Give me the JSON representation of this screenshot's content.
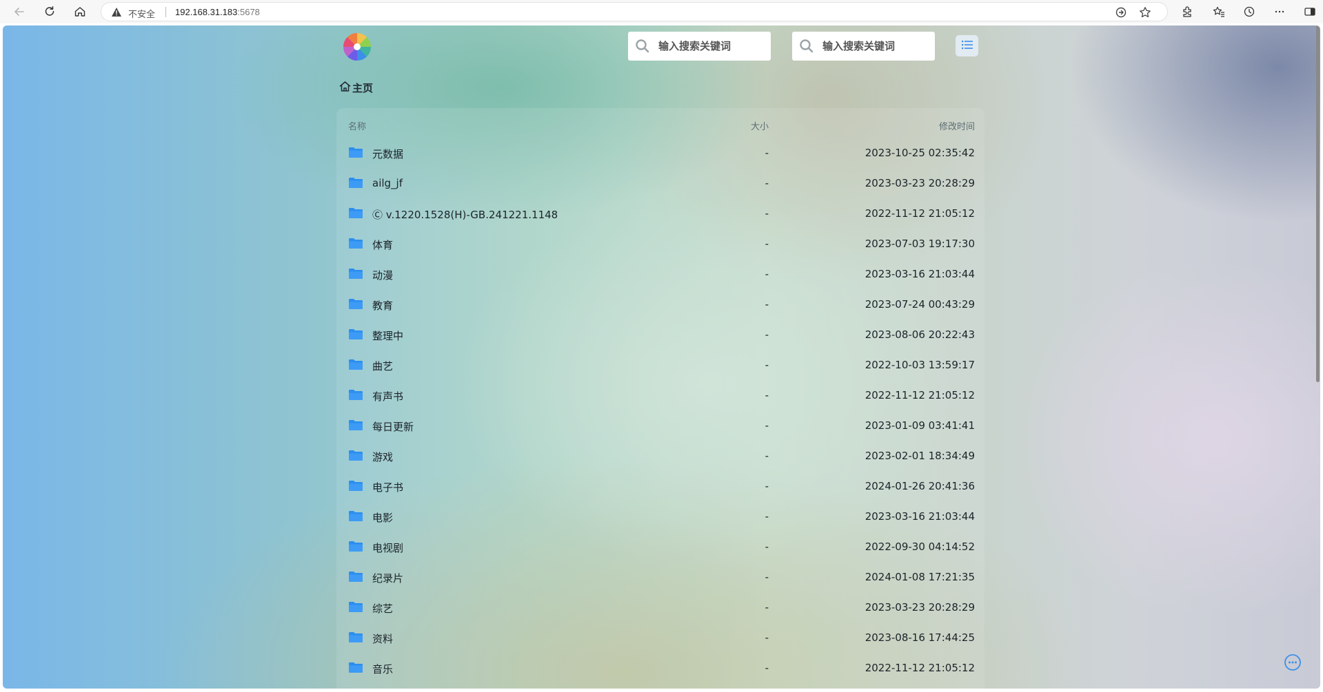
{
  "browser": {
    "security_label": "不安全",
    "url_host": "192.168.31.183",
    "url_port": ":5678"
  },
  "search": {
    "first_placeholder": "输入搜索关键词",
    "second_placeholder": "输入搜索关键词"
  },
  "breadcrumb": {
    "home_label": "主页"
  },
  "list": {
    "header": {
      "name": "名称",
      "size": "大小",
      "modified": "修改时间"
    },
    "rows": [
      {
        "name": "元数据",
        "size": "-",
        "modified": "2023-10-25 02:35:42"
      },
      {
        "name": "ailg_jf",
        "size": "-",
        "modified": "2023-03-23 20:28:29"
      },
      {
        "name": "Ⓒ v.1220.1528(H)-GB.241221.1148",
        "size": "-",
        "modified": "2022-11-12 21:05:12"
      },
      {
        "name": "体育",
        "size": "-",
        "modified": "2023-07-03 19:17:30"
      },
      {
        "name": "动漫",
        "size": "-",
        "modified": "2023-03-16 21:03:44"
      },
      {
        "name": "教育",
        "size": "-",
        "modified": "2023-07-24 00:43:29"
      },
      {
        "name": "整理中",
        "size": "-",
        "modified": "2023-08-06 20:22:43"
      },
      {
        "name": "曲艺",
        "size": "-",
        "modified": "2022-10-03 13:59:17"
      },
      {
        "name": "有声书",
        "size": "-",
        "modified": "2022-11-12 21:05:12"
      },
      {
        "name": "每日更新",
        "size": "-",
        "modified": "2023-01-09 03:41:41"
      },
      {
        "name": "游戏",
        "size": "-",
        "modified": "2023-02-01 18:34:49"
      },
      {
        "name": "电子书",
        "size": "-",
        "modified": "2024-01-26 20:41:36"
      },
      {
        "name": "电影",
        "size": "-",
        "modified": "2023-03-16 21:03:44"
      },
      {
        "name": "电视剧",
        "size": "-",
        "modified": "2022-09-30 04:14:52"
      },
      {
        "name": "纪录片",
        "size": "-",
        "modified": "2024-01-08 17:21:35"
      },
      {
        "name": "综艺",
        "size": "-",
        "modified": "2023-03-23 20:28:29"
      },
      {
        "name": "资料",
        "size": "-",
        "modified": "2023-08-16 17:44:25"
      },
      {
        "name": "音乐",
        "size": "-",
        "modified": "2022-11-12 21:05:12"
      }
    ]
  },
  "icons": {
    "folder": "folder-icon",
    "search": "search-icon",
    "list_toggle": "list-view-icon",
    "home": "home-icon",
    "more": "more-options-icon"
  },
  "colors": {
    "folder_blue": "#2b8ef0",
    "text_dark": "#1b2329",
    "header_gray": "#5e6d74",
    "toggle_blue": "#3b8fe8"
  }
}
